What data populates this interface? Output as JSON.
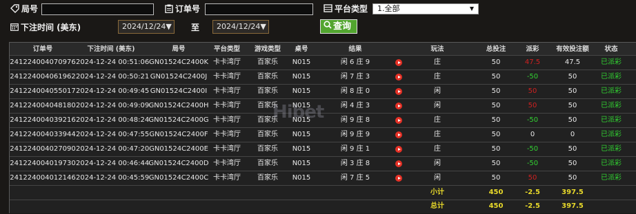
{
  "filters": {
    "order_label": "局号",
    "order_no_label": "订单号",
    "platform_label": "平台类型",
    "platform_value": "1.全部",
    "bet_time_label": "下注时间 (美东)",
    "date_from": "2024/12/24",
    "to_label": "至",
    "date_to": "2024/12/24",
    "search_label": "查询"
  },
  "table": {
    "headers": [
      "订单号",
      "下注时间 (美东)",
      "局号",
      "平台类型",
      "游戏类型",
      "桌号",
      "结果",
      "玩法",
      "总投注",
      "派彩",
      "有效投注额",
      "状态"
    ],
    "rows": [
      {
        "order": "241224004070976",
        "time": "2024-12-24 00:51:06",
        "round": "GN01524C2400K",
        "platform": "卡卡湾厅",
        "game": "百家乐",
        "table": "N015",
        "result": "闲 6 庄 9",
        "play": "庄",
        "bet": "50",
        "payout": "47.5",
        "valid": "47.5",
        "status": "已派彩",
        "payout_color": "#d02020"
      },
      {
        "order": "241224004061962",
        "time": "2024-12-24 00:50:21",
        "round": "GN01524C2400J",
        "platform": "卡卡湾厅",
        "game": "百家乐",
        "table": "N015",
        "result": "闲 7 庄 3",
        "play": "庄",
        "bet": "50",
        "payout": "-50",
        "valid": "50",
        "status": "已派彩",
        "payout_color": "#32d232"
      },
      {
        "order": "241224004055017",
        "time": "2024-12-24 00:49:45",
        "round": "GN01524C2400I",
        "platform": "卡卡湾厅",
        "game": "百家乐",
        "table": "N015",
        "result": "闲 8 庄 0",
        "play": "闲",
        "bet": "50",
        "payout": "50",
        "valid": "50",
        "status": "已派彩",
        "payout_color": "#d02020"
      },
      {
        "order": "241224004048180",
        "time": "2024-12-24 00:49:09",
        "round": "GN01524C2400H",
        "platform": "卡卡湾厅",
        "game": "百家乐",
        "table": "N015",
        "result": "闲 4 庄 3",
        "play": "闲",
        "bet": "50",
        "payout": "50",
        "valid": "50",
        "status": "已派彩",
        "payout_color": "#d02020"
      },
      {
        "order": "241224004039216",
        "time": "2024-12-24 00:48:24",
        "round": "GN01524C2400G",
        "platform": "卡卡湾厅",
        "game": "百家乐",
        "table": "N015",
        "result": "闲 9 庄 8",
        "play": "庄",
        "bet": "50",
        "payout": "-50",
        "valid": "50",
        "status": "已派彩",
        "payout_color": "#32d232"
      },
      {
        "order": "241224004033944",
        "time": "2024-12-24 00:47:55",
        "round": "GN01524C2400F",
        "platform": "卡卡湾厅",
        "game": "百家乐",
        "table": "N015",
        "result": "闲 9 庄 9",
        "play": "庄",
        "bet": "50",
        "payout": "0",
        "valid": "0",
        "status": "已派彩",
        "payout_color": "#e8e8e8"
      },
      {
        "order": "241224004027090",
        "time": "2024-12-24 00:47:20",
        "round": "GN01524C2400E",
        "platform": "卡卡湾厅",
        "game": "百家乐",
        "table": "N015",
        "result": "闲 9 庄 1",
        "play": "庄",
        "bet": "50",
        "payout": "-50",
        "valid": "50",
        "status": "已派彩",
        "payout_color": "#32d232"
      },
      {
        "order": "241224004019730",
        "time": "2024-12-24 00:46:44",
        "round": "GN01524C2400D",
        "platform": "卡卡湾厅",
        "game": "百家乐",
        "table": "N015",
        "result": "闲 3 庄 8",
        "play": "闲",
        "bet": "50",
        "payout": "-50",
        "valid": "50",
        "status": "已派彩",
        "payout_color": "#32d232"
      },
      {
        "order": "241224004012146",
        "time": "2024-12-24 00:45:59",
        "round": "GN01524C2400C",
        "platform": "卡卡湾厅",
        "game": "百家乐",
        "table": "N015",
        "result": "闲 7 庄 5",
        "play": "闲",
        "bet": "50",
        "payout": "50",
        "valid": "50",
        "status": "已派彩",
        "payout_color": "#d02020"
      }
    ],
    "subtotal": {
      "label": "小计",
      "bet": "450",
      "payout": "-2.5",
      "valid": "397.5"
    },
    "total": {
      "label": "总计",
      "bet": "450",
      "payout": "-2.5",
      "valid": "397.5"
    }
  },
  "watermark": "Hibet",
  "colors": {
    "accent": "#52a52f",
    "win_red": "#d02020",
    "lose_green": "#32d232",
    "summary_yellow": "#e8d92a"
  }
}
